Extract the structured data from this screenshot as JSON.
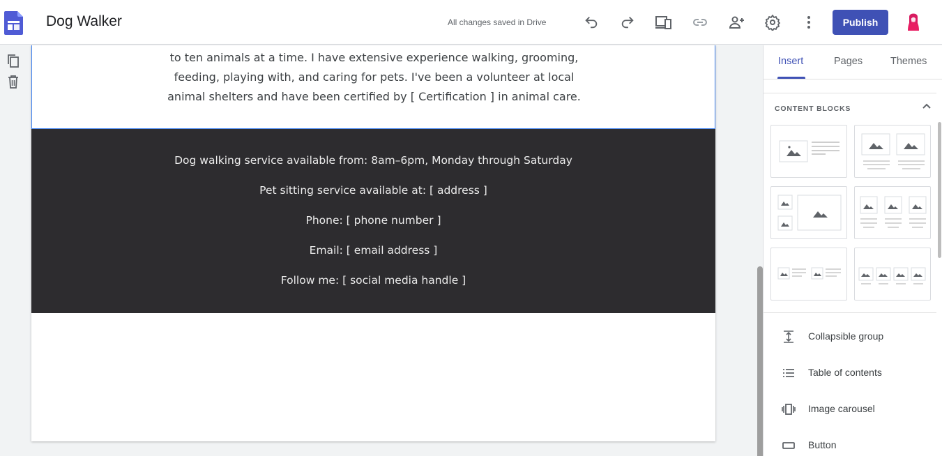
{
  "header": {
    "title": "Dog Walker",
    "save_status": "All changes saved in Drive",
    "publish_label": "Publish"
  },
  "page": {
    "intro_lines": [
      "to ten animals at a time. I have extensive experience walking, grooming,",
      "feeding, playing with, and caring for pets. I've been a volunteer at local",
      "animal shelters and have been certified by [ Certification ] in animal care."
    ],
    "contact_lines": [
      "Dog walking service available from: 8am–6pm, Monday through Saturday",
      "Pet sitting service available at: [ address ]",
      "Phone: [ phone number ]",
      "Email: [ email address ]",
      "Follow me: [ social media handle ]"
    ]
  },
  "panel": {
    "tabs": [
      "Insert",
      "Pages",
      "Themes"
    ],
    "active_tab": "Insert",
    "content_blocks_label": "CONTENT BLOCKS",
    "items": [
      {
        "label": "Collapsible group",
        "icon": "collapsible-group-icon"
      },
      {
        "label": "Table of contents",
        "icon": "table-of-contents-icon"
      },
      {
        "label": "Image carousel",
        "icon": "image-carousel-icon"
      },
      {
        "label": "Button",
        "icon": "button-icon"
      }
    ]
  },
  "colors": {
    "accent": "#3f51b5",
    "dark_section": "#2d2c2f",
    "selection_border": "#4285f4"
  }
}
